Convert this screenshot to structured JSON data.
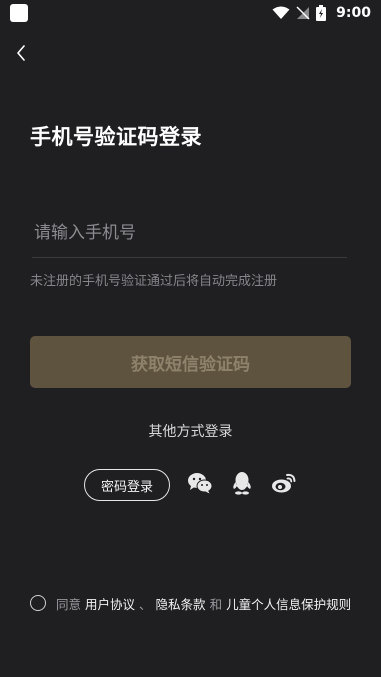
{
  "status_bar": {
    "time": "9:00"
  },
  "login": {
    "title": "手机号验证码登录",
    "phone_placeholder": "请输入手机号",
    "phone_value": "",
    "hint": "未注册的手机号验证通过后将自动完成注册",
    "get_code_label": "获取短信验证码",
    "other_methods_label": "其他方式登录",
    "password_login_label": "密码登录"
  },
  "icons": {
    "back": "chevron-left-icon",
    "wechat": "wechat-icon",
    "qq": "qq-icon",
    "weibo": "weibo-icon"
  },
  "agreement": {
    "prefix": "同意",
    "user_agreement": "用户协议",
    "separator": "、",
    "privacy": "隐私条款",
    "and": "和",
    "child_privacy": "儿童个人信息保护规则"
  },
  "colors": {
    "background": "#1f1f22",
    "button_disabled_bg": "#5e533f",
    "button_disabled_text": "#8e826b"
  }
}
